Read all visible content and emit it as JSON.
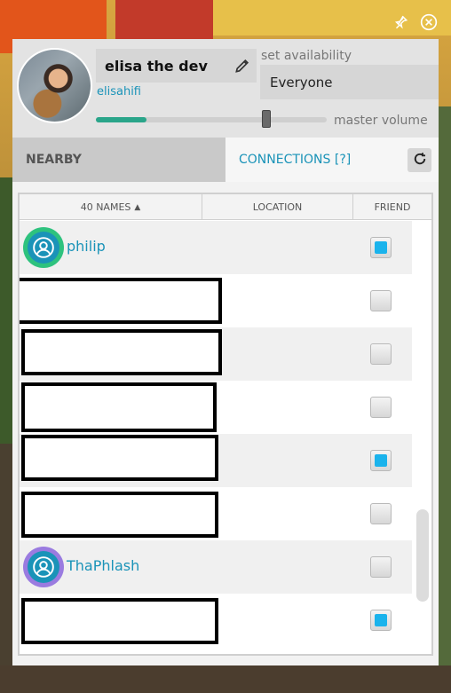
{
  "window": {
    "pin_icon": "pin-icon",
    "close_icon": "close-icon"
  },
  "profile": {
    "display_name": "elisa the dev",
    "username": "elisahifi",
    "availability_label": "set availability",
    "availability_value": "Everyone",
    "volume_label": "master volume",
    "volume_level": 0.74,
    "volume_accent": "#2aa58a"
  },
  "tabs": {
    "nearby": "NEARBY",
    "connections": "CONNECTIONS [?]",
    "accent": "#1a93b8"
  },
  "table": {
    "headers": {
      "names": "40 NAMES",
      "location": "LOCATION",
      "friend": "FRIEND"
    },
    "rows": [
      {
        "name": "philip",
        "redacted": false,
        "friend": true,
        "ring": "#2ec27e"
      },
      {
        "name": "",
        "redacted": true,
        "friend": false
      },
      {
        "name": "",
        "redacted": true,
        "friend": false
      },
      {
        "name": "",
        "redacted": true,
        "friend": false
      },
      {
        "name": "",
        "redacted": true,
        "friend": true
      },
      {
        "name": "",
        "redacted": true,
        "friend": false
      },
      {
        "name": "ThaPhlash",
        "redacted": false,
        "friend": false,
        "ring": "#9a7be0"
      },
      {
        "name": "",
        "redacted": true,
        "friend": true
      }
    ]
  }
}
